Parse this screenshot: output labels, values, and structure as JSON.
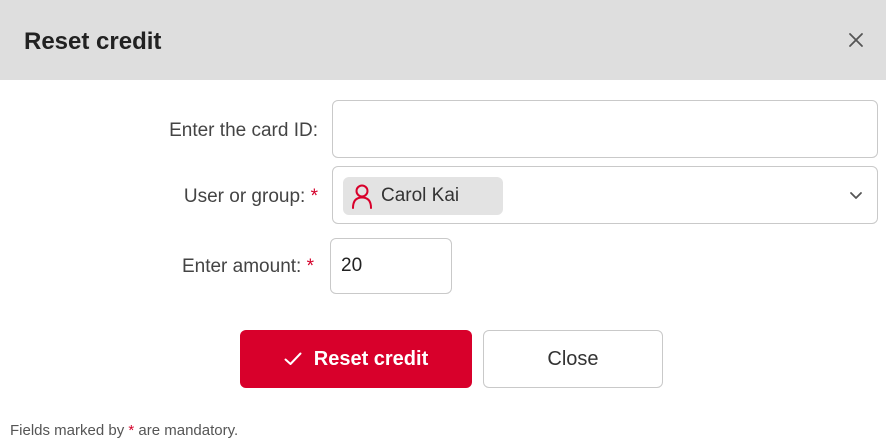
{
  "dialog": {
    "title": "Reset credit",
    "close_icon": "close-icon"
  },
  "form": {
    "card_id": {
      "label": "Enter the card ID:",
      "value": "",
      "placeholder": ""
    },
    "user_group": {
      "label": "User or group:",
      "required_mark": "*",
      "selected": "Carol Kai",
      "icon": "user-icon",
      "dropdown_icon": "chevron-down-icon"
    },
    "amount": {
      "label": "Enter amount:",
      "required_mark": "*",
      "value": "20"
    }
  },
  "buttons": {
    "reset_label": "Reset credit",
    "reset_icon": "check-icon",
    "close_label": "Close"
  },
  "footer": {
    "prefix": "Fields marked by",
    "mark": "*",
    "suffix": "are mandatory."
  },
  "colors": {
    "accent": "#d8002b",
    "header_bg": "#dedede",
    "chip_bg": "#e3e3e3"
  }
}
